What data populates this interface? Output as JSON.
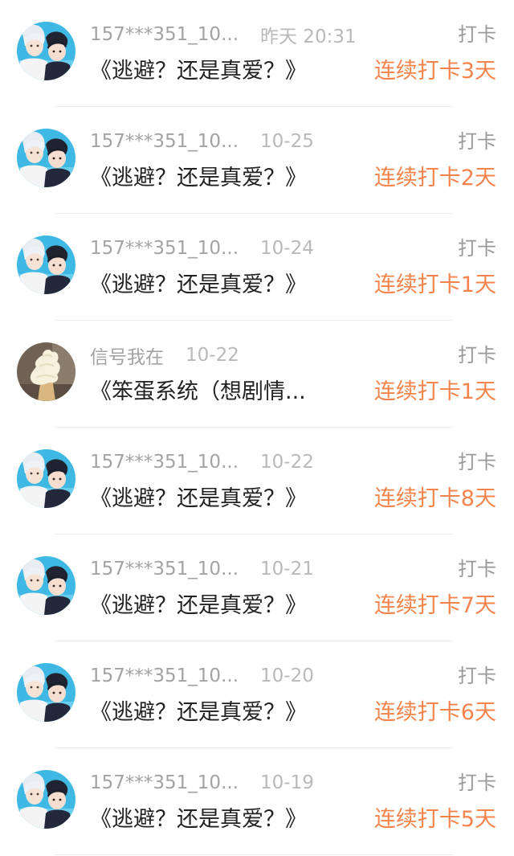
{
  "feed": {
    "items": [
      {
        "avatar": "couple-photo",
        "username": "157***351_10...",
        "time": "昨天 20:31",
        "tag": "打卡",
        "title": "《逃避？还是真爱？》",
        "streak": "连续打卡3天"
      },
      {
        "avatar": "couple-photo",
        "username": "157***351_10...",
        "time": "10-25",
        "tag": "打卡",
        "title": "《逃避？还是真爱？》",
        "streak": "连续打卡2天"
      },
      {
        "avatar": "couple-photo",
        "username": "157***351_10...",
        "time": "10-24",
        "tag": "打卡",
        "title": "《逃避？还是真爱？》",
        "streak": "连续打卡1天"
      },
      {
        "avatar": "ice-cream-photo",
        "username": "信号我在",
        "time": "10-22",
        "tag": "打卡",
        "title": "《笨蛋系统（想剧情...",
        "streak": "连续打卡1天"
      },
      {
        "avatar": "couple-photo",
        "username": "157***351_10...",
        "time": "10-22",
        "tag": "打卡",
        "title": "《逃避？还是真爱？》",
        "streak": "连续打卡8天"
      },
      {
        "avatar": "couple-photo",
        "username": "157***351_10...",
        "time": "10-21",
        "tag": "打卡",
        "title": "《逃避？还是真爱？》",
        "streak": "连续打卡7天"
      },
      {
        "avatar": "couple-photo",
        "username": "157***351_10...",
        "time": "10-20",
        "tag": "打卡",
        "title": "《逃避？还是真爱？》",
        "streak": "连续打卡6天"
      },
      {
        "avatar": "couple-photo",
        "username": "157***351_10...",
        "time": "10-19",
        "tag": "打卡",
        "title": "《逃避？还是真爱？》",
        "streak": "连续打卡5天"
      }
    ]
  },
  "colors": {
    "username": "#a3a3a3",
    "time": "#b9b9b9",
    "tag": "#9a9a9a",
    "title": "#222222",
    "streak": "#f5844c",
    "divider": "#ececec"
  }
}
